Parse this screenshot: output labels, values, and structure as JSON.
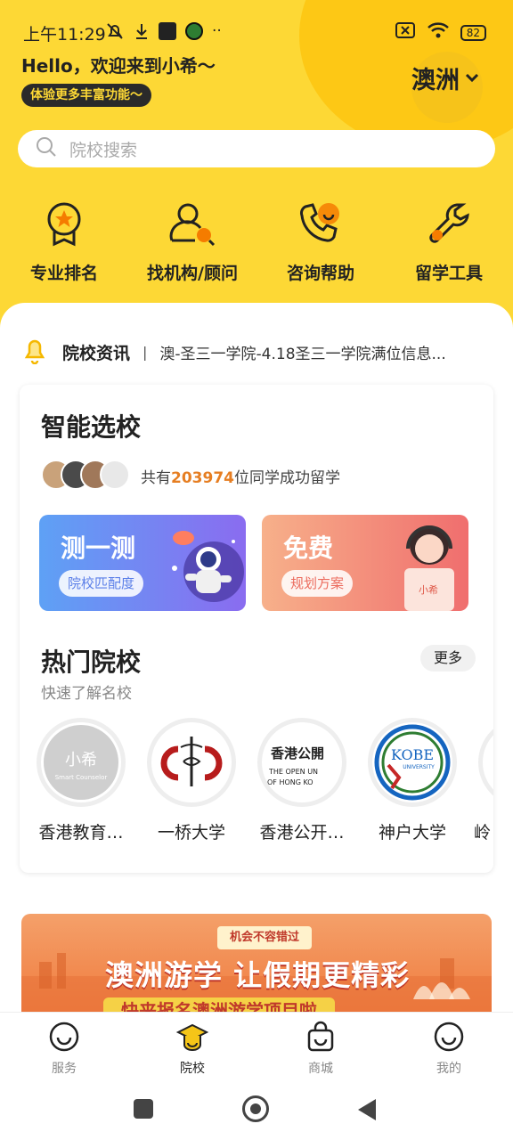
{
  "status_bar": {
    "time": "上午11:29",
    "battery": "82"
  },
  "header": {
    "greeting": "Hello，欢迎来到小希～",
    "feature_pill": "体验更多丰富功能～",
    "region": "澳洲"
  },
  "search": {
    "placeholder": "院校搜索"
  },
  "quick_actions": [
    {
      "label": "专业排名",
      "icon": "ranking-badge-icon"
    },
    {
      "label": "找机构/顾问",
      "icon": "find-advisor-icon"
    },
    {
      "label": "咨询帮助",
      "icon": "phone-chat-icon"
    },
    {
      "label": "留学工具",
      "icon": "wrench-icon"
    }
  ],
  "news": {
    "title": "院校资讯",
    "text": "澳-圣三一学院-4.18圣三一学院满位信息..."
  },
  "smart_select": {
    "title": "智能选校",
    "count_prefix": "共有",
    "count": "203974",
    "count_suffix": "位同学成功留学",
    "banners": [
      {
        "title": "测一测",
        "subtitle": "院校匹配度"
      },
      {
        "title": "免费",
        "subtitle": "规划方案",
        "mascot_label": "小希"
      }
    ]
  },
  "hot_schools": {
    "title": "热门院校",
    "subtitle": "快速了解名校",
    "more": "更多",
    "schools": [
      {
        "name": "香港教育…",
        "logo_text": "小希",
        "logo_sub": "Smart Counselor"
      },
      {
        "name": "一桥大学"
      },
      {
        "name": "香港公开…",
        "logo_text": "香港公開",
        "logo_sub1": "THE OPEN UN",
        "logo_sub2": "OF HONG KO"
      },
      {
        "name": "神户大学",
        "logo_text": "KOBE",
        "logo_sub": "UNIVERSITY"
      },
      {
        "name": "岭"
      }
    ]
  },
  "promo": {
    "tag": "机会不容错过",
    "title": "澳洲游学 让假期更精彩",
    "subtitle": "快来报名澳洲游学项目啦"
  },
  "tabs": [
    {
      "label": "服务",
      "active": false
    },
    {
      "label": "院校",
      "active": true
    },
    {
      "label": "商城",
      "active": false
    },
    {
      "label": "我的",
      "active": false
    }
  ],
  "colors": {
    "brand_yellow": "#fdd835",
    "accent_orange": "#e67e22"
  }
}
